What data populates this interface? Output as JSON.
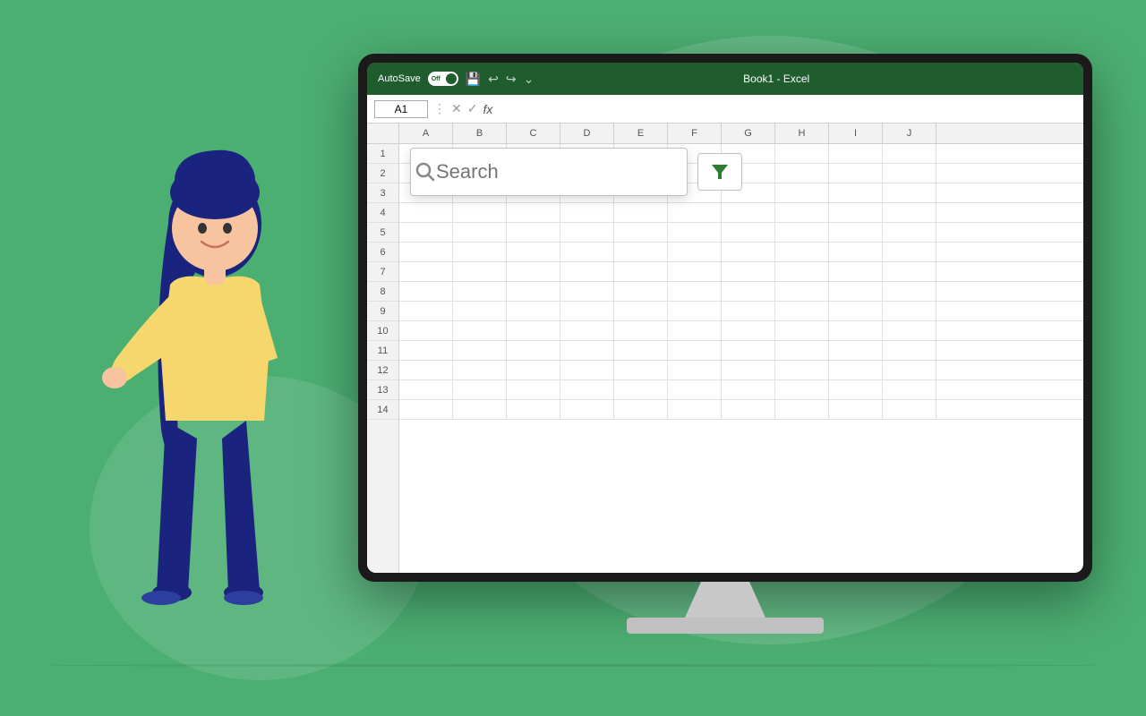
{
  "background": {
    "color": "#4caf72"
  },
  "titlebar": {
    "autosave_label": "AutoSave",
    "toggle_state": "Off",
    "title": "Book1  -  Excel"
  },
  "formulabar": {
    "cell_ref": "A1",
    "formula": ""
  },
  "columns": [
    "A",
    "B",
    "C",
    "D",
    "E",
    "F",
    "G",
    "H",
    "I",
    "J"
  ],
  "rows": [
    1,
    2,
    3,
    4,
    5,
    6,
    7,
    8,
    9,
    10,
    11,
    12,
    13,
    14
  ],
  "search": {
    "placeholder": "Search",
    "value": ""
  },
  "buttons": {
    "filter_label": "▼",
    "filter_title": "Filter"
  }
}
